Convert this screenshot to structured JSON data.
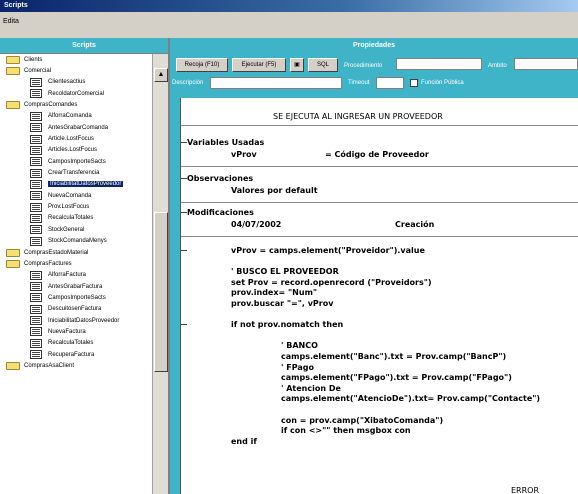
{
  "window": {
    "title": "Scripts"
  },
  "menu": {
    "items": [
      "Edita"
    ]
  },
  "left_panel": {
    "header": "Scripts",
    "tree": [
      {
        "label": "Clients",
        "level": 0,
        "type": "folder"
      },
      {
        "label": "Comercial",
        "level": 0,
        "type": "folder"
      },
      {
        "label": "Clientesactius",
        "level": 1,
        "type": "doc"
      },
      {
        "label": "RecoldatorComercial",
        "level": 1,
        "type": "doc"
      },
      {
        "label": "ComprasComandes",
        "level": 0,
        "type": "folder"
      },
      {
        "label": "AlforraComanda",
        "level": 1,
        "type": "doc"
      },
      {
        "label": "AntesGrabarComanda",
        "level": 1,
        "type": "doc"
      },
      {
        "label": "Article.LostFocus",
        "level": 1,
        "type": "doc"
      },
      {
        "label": "Articles.LostFocus",
        "level": 1,
        "type": "doc"
      },
      {
        "label": "CamposImporteSacts",
        "level": 1,
        "type": "doc"
      },
      {
        "label": "CrearTransferencia",
        "level": 1,
        "type": "doc"
      },
      {
        "label": "IniciabilitatDatosProveedor",
        "level": 1,
        "type": "doc",
        "selected": true
      },
      {
        "label": "NuevaComanda",
        "level": 1,
        "type": "doc"
      },
      {
        "label": "Prov.LostFocus",
        "level": 1,
        "type": "doc"
      },
      {
        "label": "RecalculaTotales",
        "level": 1,
        "type": "doc"
      },
      {
        "label": "StockGeneral",
        "level": 1,
        "type": "doc"
      },
      {
        "label": "StockComandaMenys",
        "level": 1,
        "type": "doc"
      },
      {
        "label": "ComprasEstadoMaterial",
        "level": 0,
        "type": "folder"
      },
      {
        "label": "ComprasFactures",
        "level": 0,
        "type": "folder"
      },
      {
        "label": "AlforraFactura",
        "level": 1,
        "type": "doc"
      },
      {
        "label": "AntesGrabarFactura",
        "level": 1,
        "type": "doc"
      },
      {
        "label": "CamposImporteSacts",
        "level": 1,
        "type": "doc"
      },
      {
        "label": "DescuitosenFactura",
        "level": 1,
        "type": "doc"
      },
      {
        "label": "IniciabilitatDatosProveedor",
        "level": 1,
        "type": "doc"
      },
      {
        "label": "NuevaFactura",
        "level": 1,
        "type": "doc"
      },
      {
        "label": "RecalculaTotales",
        "level": 1,
        "type": "doc"
      },
      {
        "label": "RecuperaFactura",
        "level": 1,
        "type": "doc"
      },
      {
        "label": "ComprasAsaClient",
        "level": 0,
        "type": "folder"
      }
    ]
  },
  "right_panel": {
    "header": "Propiedades",
    "toolbar": {
      "btn_1": "Recoja (F10)",
      "btn_2": "Ejecutar (F5)",
      "btn_3": "SQL",
      "label_1": "Procedimiento",
      "label_2": "Ambito",
      "label_3": "Descripción",
      "label_4": "Timeout",
      "label_5": "Función Pública"
    },
    "script": {
      "title": "SE EJECUTA AL INGRESAR UN PROVEEDOR",
      "sections": [
        {
          "heading": "Variables Usadas",
          "lines": [
            {
              "col1": "vProv",
              "col2": "= Código de Proveedor"
            }
          ]
        },
        {
          "heading": "Observaciones",
          "lines": [
            {
              "col1": "Valores por default",
              "col2": ""
            }
          ]
        },
        {
          "heading": "Modificaciones",
          "lines": [
            {
              "col1": "04/07/2002",
              "col2": "Creación"
            }
          ]
        }
      ],
      "code": [
        "vProv = camps.element(\"Proveidor\").value",
        "",
        "' BUSCO EL PROVEEDOR",
        "set Prov = record.openrecord (\"Proveidors\")",
        "prov.index= \"Num\"",
        "prov.buscar \"=\", vProv",
        "",
        "if not prov.nomatch then",
        "",
        "' BANCO",
        "camps.element(\"Banc\").txt      = Prov.camp(\"BancP\")",
        "' FPago",
        "camps.element(\"FPago\").txt     = Prov.camp(\"FPago\")",
        "' Atencion De",
        "camps.element(\"AtencioDe\").txt= Prov.camp(\"Contacte\")",
        "",
        "con = prov.camp(\"XibatoComanda\")",
        "if con <>\"\" then msgbox con",
        "end if"
      ],
      "footer_fragment": "ERROR"
    }
  }
}
